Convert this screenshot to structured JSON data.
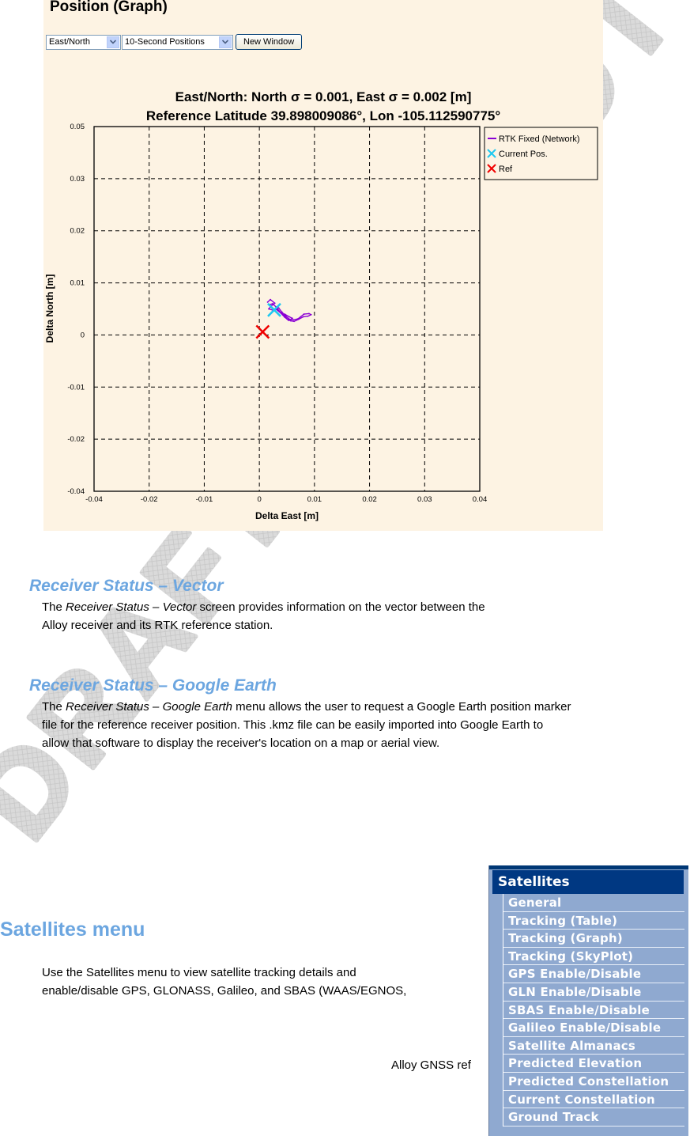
{
  "panel": {
    "title": "Position (Graph)",
    "view_select": {
      "value": "East/North"
    },
    "interval_select": {
      "value": "10-Second Positions"
    },
    "new_window_label": "New Window"
  },
  "chart_data": {
    "type": "scatter",
    "title": "East/North: North σ = 0.001, East σ = 0.002 [m]",
    "subtitle": "Reference Latitude 39.898009086°, Lon -105.112590775°",
    "xlabel": "Delta East [m]",
    "ylabel": "Delta North [m]",
    "x_ticks": [
      "-0.04",
      "-0.02",
      "-0.01",
      "0",
      "0.01",
      "0.02",
      "0.03",
      "0.04"
    ],
    "y_ticks": [
      "0.05",
      "0.03",
      "0.02",
      "0.01",
      "0",
      "-0.01",
      "-0.02",
      "-0.04"
    ],
    "xlim": [
      -0.04,
      0.04
    ],
    "ylim": [
      -0.04,
      0.05
    ],
    "grid": true,
    "legend_position": "top-right-outside",
    "legend": [
      {
        "label": "RTK Fixed (Network)",
        "marker": "line",
        "color": "#8a00d4"
      },
      {
        "label": "Current Pos.",
        "marker": "x",
        "color": "#1ec8f0"
      },
      {
        "label": "Ref",
        "marker": "x",
        "color": "#f00000"
      }
    ],
    "series": [
      {
        "name": "RTK Fixed (Network)",
        "color": "#8a00d4",
        "points": [
          [
            0.0015,
            0.0063
          ],
          [
            0.002,
            0.0068
          ],
          [
            0.0028,
            0.0061
          ],
          [
            0.0022,
            0.0056
          ],
          [
            0.0017,
            0.005
          ],
          [
            0.0026,
            0.0047
          ],
          [
            0.0035,
            0.0052
          ],
          [
            0.0041,
            0.0044
          ],
          [
            0.0048,
            0.0036
          ],
          [
            0.0055,
            0.003
          ],
          [
            0.0062,
            0.0029
          ],
          [
            0.007,
            0.0031
          ],
          [
            0.0075,
            0.0035
          ],
          [
            0.0081,
            0.004
          ],
          [
            0.009,
            0.0041
          ],
          [
            0.0094,
            0.0039
          ],
          [
            0.0088,
            0.0036
          ],
          [
            0.008,
            0.0035
          ],
          [
            0.0071,
            0.003
          ],
          [
            0.0063,
            0.0026
          ],
          [
            0.0057,
            0.0027
          ],
          [
            0.005,
            0.0031
          ],
          [
            0.0043,
            0.0039
          ],
          [
            0.0036,
            0.0046
          ],
          [
            0.003,
            0.0054
          ],
          [
            0.0024,
            0.006
          ],
          [
            0.0018,
            0.0058
          ],
          [
            0.0023,
            0.0051
          ],
          [
            0.0031,
            0.0049
          ],
          [
            0.0039,
            0.0042
          ],
          [
            0.0046,
            0.0034
          ],
          [
            0.0053,
            0.0028
          ],
          [
            0.006,
            0.0032
          ],
          [
            0.0054,
            0.0035
          ],
          [
            0.0046,
            0.004
          ]
        ]
      },
      {
        "name": "Current Pos.",
        "color": "#1ec8f0",
        "points": [
          [
            0.0027,
            0.0048
          ]
        ]
      },
      {
        "name": "Ref",
        "color": "#f00000",
        "points": [
          [
            0.0006,
            0.0006
          ]
        ]
      }
    ]
  },
  "sections": [
    {
      "heading": "Receiver Status – Vector",
      "lines": [
        {
          "prefix": "The ",
          "italic": "Receiver Status – Vector",
          "rest": " screen provides information on the vector between the"
        },
        {
          "text": "Alloy receiver and its RTK reference station."
        }
      ]
    },
    {
      "heading": "Receiver Status – Google Earth",
      "lines": [
        {
          "prefix": "The ",
          "italic": "Receiver Status – Google Earth",
          "rest": " menu allows the user to request a Google Earth position marker"
        },
        {
          "text": "file for the reference receiver position. This .kmz file can be easily imported into Google Earth to"
        },
        {
          "text": "allow that software to display the receiver's location on a map or aerial view."
        }
      ]
    }
  ],
  "satellites_section": {
    "heading": "Satellites menu",
    "lines": [
      "Use the Satellites menu to view satellite tracking details and",
      "enable/disable GPS, GLONASS, Galileo, and SBAS (WAAS/EGNOS,"
    ]
  },
  "footer_text": "Alloy GNSS ref",
  "menu": {
    "header": "Satellites",
    "items": [
      "General",
      "Tracking (Table)",
      "Tracking (Graph)",
      "Tracking (SkyPlot)",
      "GPS Enable/Disable",
      "GLN Enable/Disable",
      "SBAS Enable/Disable",
      "Galileo Enable/Disable",
      "Satellite Almanacs",
      "Predicted Elevation",
      "Predicted Constellation",
      "Current Constellation",
      "Ground Track"
    ]
  },
  "watermark_text": "DRAFT - DO NOT DUPLICATE"
}
